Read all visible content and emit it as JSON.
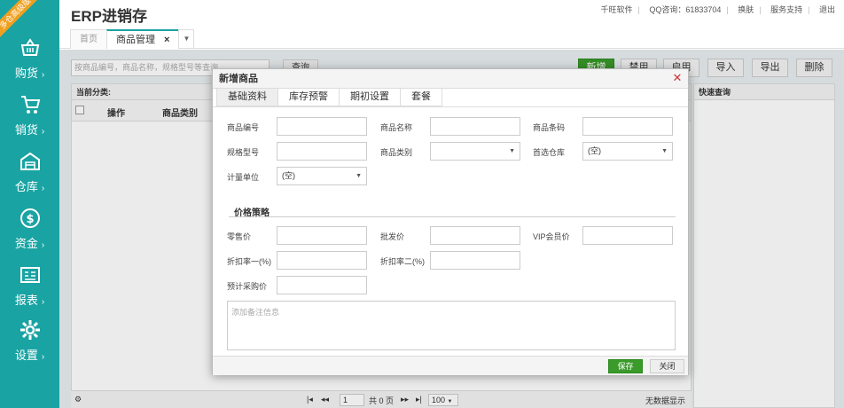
{
  "sidebar": {
    "badge": "多仓高级版",
    "items": [
      {
        "label": "购货",
        "icon": "basket-icon"
      },
      {
        "label": "销货",
        "icon": "cart-icon"
      },
      {
        "label": "仓库",
        "icon": "warehouse-icon"
      },
      {
        "label": "资金",
        "icon": "dollar-icon"
      },
      {
        "label": "报表",
        "icon": "report-icon"
      },
      {
        "label": "设置",
        "icon": "gear-icon"
      }
    ]
  },
  "header": {
    "title": "ERP进销存",
    "links": {
      "company": "千旺软件",
      "qq": "QQ咨询：61833704",
      "skin": "换肤",
      "support": "服务支持",
      "logout": "退出"
    },
    "tabs": [
      {
        "label": "首页"
      },
      {
        "label": "商品管理"
      }
    ]
  },
  "toolbar": {
    "search_placeholder": "按商品编号，商品名称，规格型号等查询",
    "query": "查询",
    "add": "新增",
    "disable": "禁用",
    "enable": "启用",
    "import": "导入",
    "export": "导出",
    "delete": "删除"
  },
  "panel": {
    "category": "当前分类:",
    "col_op": "操作",
    "col_category": "商品类别",
    "quick_query": "快速查询"
  },
  "pager": {
    "first": "|◂",
    "prev": "◂◂",
    "page": "1",
    "total": "共 0 页",
    "next": "▸▸",
    "last": "▸|",
    "size": "100",
    "no_data": "无数据显示"
  },
  "modal": {
    "title": "新增商品",
    "tabs": [
      "基础资料",
      "库存预警",
      "期初设置",
      "套餐"
    ],
    "labels": {
      "code": "商品编号",
      "name": "商品名称",
      "barcode": "商品条码",
      "spec": "规格型号",
      "category": "商品类别",
      "warehouse": "首选仓库",
      "unit": "计量单位",
      "price_section": "价格策略",
      "retail": "零售价",
      "wholesale": "批发价",
      "vip": "VIP会员价",
      "discount1": "折扣率一(%)",
      "discount2": "折扣率二(%)",
      "purchase": "预计采购价"
    },
    "values": {
      "warehouse": "(空)",
      "unit": "(空)",
      "category": ""
    },
    "remark_placeholder": "添加备注信息",
    "save": "保存",
    "close": "关闭"
  }
}
